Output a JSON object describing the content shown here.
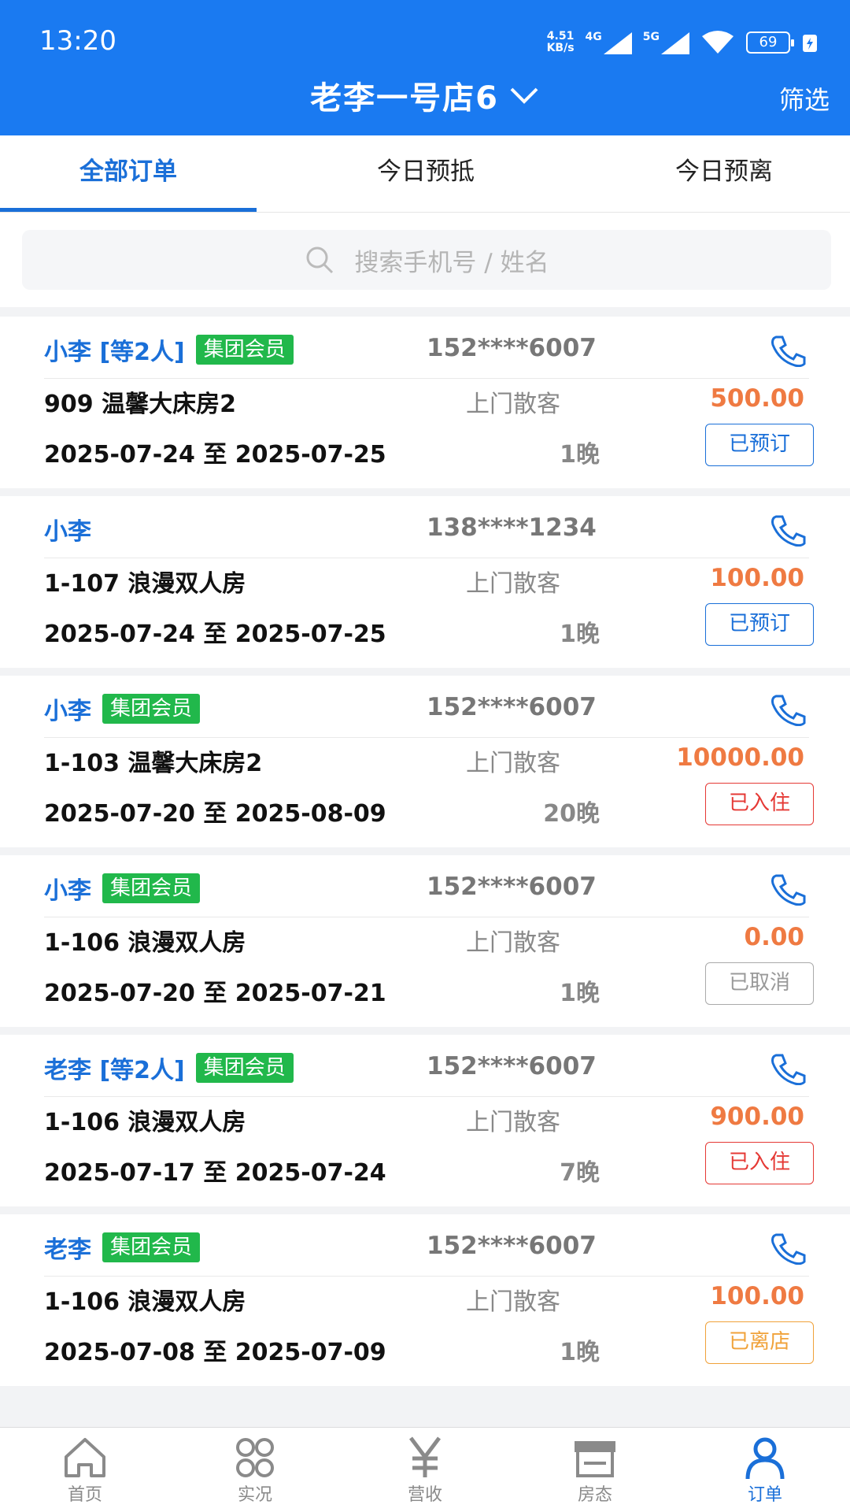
{
  "status_bar": {
    "time": "13:20",
    "net_speed_top": "4.51",
    "net_speed_bottom": "KB/s",
    "sig1": "4G",
    "sig2": "5G",
    "battery": "69"
  },
  "header": {
    "store_name": "老李一号店6",
    "filter_label": "筛选"
  },
  "tabs": [
    {
      "label": "全部订单"
    },
    {
      "label": "今日预抵"
    },
    {
      "label": "今日预离"
    }
  ],
  "search": {
    "placeholder": "搜索手机号 / 姓名"
  },
  "orders": [
    {
      "guest": "小李 [等2人]",
      "badge": "集团会员",
      "phone": "152****6007",
      "room": "909 温馨大床房2",
      "source": "上门散客",
      "price": "500.00",
      "dates": "2025-07-24 至 2025-07-25",
      "nights": "1晚",
      "status": "已预订"
    },
    {
      "guest": "小李",
      "badge": "",
      "phone": "138****1234",
      "room": "1-107 浪漫双人房",
      "source": "上门散客",
      "price": "100.00",
      "dates": "2025-07-24 至 2025-07-25",
      "nights": "1晚",
      "status": "已预订"
    },
    {
      "guest": "小李",
      "badge": "集团会员",
      "phone": "152****6007",
      "room": "1-103 温馨大床房2",
      "source": "上门散客",
      "price": "10000.00",
      "dates": "2025-07-20 至 2025-08-09",
      "nights": "20晚",
      "status": "已入住"
    },
    {
      "guest": "小李",
      "badge": "集团会员",
      "phone": "152****6007",
      "room": "1-106 浪漫双人房",
      "source": "上门散客",
      "price": "0.00",
      "dates": "2025-07-20 至 2025-07-21",
      "nights": "1晚",
      "status": "已取消"
    },
    {
      "guest": "老李 [等2人]",
      "badge": "集团会员",
      "phone": "152****6007",
      "room": "1-106 浪漫双人房",
      "source": "上门散客",
      "price": "900.00",
      "dates": "2025-07-17 至 2025-07-24",
      "nights": "7晚",
      "status": "已入住"
    },
    {
      "guest": "老李",
      "badge": "集团会员",
      "phone": "152****6007",
      "room": "1-106 浪漫双人房",
      "source": "上门散客",
      "price": "100.00",
      "dates": "2025-07-08 至 2025-07-09",
      "nights": "1晚",
      "status": "已离店"
    }
  ],
  "bottom_nav": [
    {
      "label": "首页",
      "icon": "home-icon"
    },
    {
      "label": "实况",
      "icon": "grid-circles-icon"
    },
    {
      "label": "营收",
      "icon": "yen-icon"
    },
    {
      "label": "房态",
      "icon": "store-icon"
    },
    {
      "label": "订单",
      "icon": "user-icon"
    }
  ],
  "colors": {
    "brand": "#1a7af1",
    "active_tab": "#1a6fd8",
    "member_badge": "#21b84b",
    "price": "#ef7a42",
    "checked_in": "#e53935",
    "checked_out": "#f0a23a",
    "cancelled": "#999999"
  }
}
